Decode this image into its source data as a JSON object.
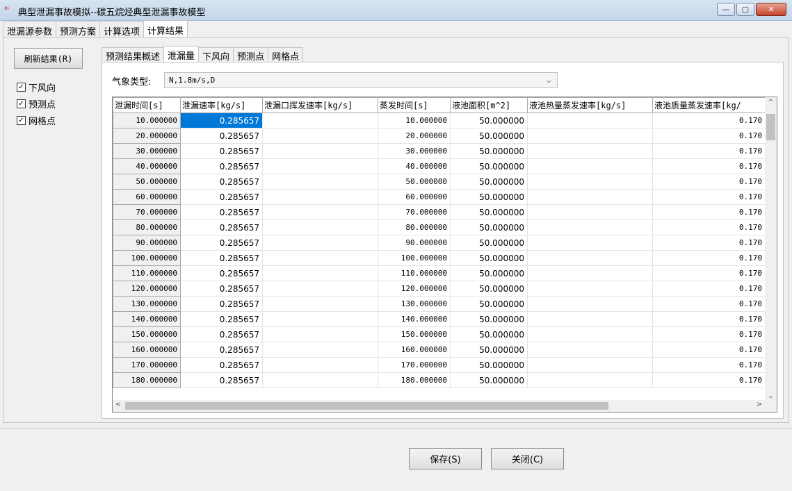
{
  "window": {
    "icon_text": "ᴿˢ",
    "title": "典型泄漏事故模拟--碳五烷烃典型泄漏事故模型",
    "buttons": {
      "minimize": "—",
      "maximize": "▢",
      "close": "✕"
    }
  },
  "outer_tabs": [
    {
      "label": "泄漏源参数",
      "active": false
    },
    {
      "label": "预测方案",
      "active": false
    },
    {
      "label": "计算选项",
      "active": false
    },
    {
      "label": "计算结果",
      "active": true
    }
  ],
  "left_panel": {
    "refresh_label": "刷新结果(R)",
    "checkboxes": [
      {
        "label": "下风向",
        "checked": true
      },
      {
        "label": "预测点",
        "checked": true
      },
      {
        "label": "网格点",
        "checked": true
      }
    ]
  },
  "inner_tabs": [
    {
      "label": "预测结果概述",
      "active": false
    },
    {
      "label": "泄漏量",
      "active": true
    },
    {
      "label": "下风向",
      "active": false
    },
    {
      "label": "预测点",
      "active": false
    },
    {
      "label": "网格点",
      "active": false
    }
  ],
  "weather": {
    "label": "气象类型:",
    "value": "N,1.8m/s,D",
    "chevron": "⌵"
  },
  "grid": {
    "headers": [
      "泄漏时间[s]",
      "泄漏速率[kg/s]",
      "泄漏口挥发速率[kg/s]",
      "蒸发时间[s]",
      "液池面积[m^2]",
      "液池热量蒸发速率[kg/s]",
      "液池质量蒸发速率[kg/"
    ],
    "rows": [
      [
        "10.000000",
        "0.285657",
        "",
        "10.000000",
        "50.000000",
        "",
        "0.170"
      ],
      [
        "20.000000",
        "0.285657",
        "",
        "20.000000",
        "50.000000",
        "",
        "0.170"
      ],
      [
        "30.000000",
        "0.285657",
        "",
        "30.000000",
        "50.000000",
        "",
        "0.170"
      ],
      [
        "40.000000",
        "0.285657",
        "",
        "40.000000",
        "50.000000",
        "",
        "0.170"
      ],
      [
        "50.000000",
        "0.285657",
        "",
        "50.000000",
        "50.000000",
        "",
        "0.170"
      ],
      [
        "60.000000",
        "0.285657",
        "",
        "60.000000",
        "50.000000",
        "",
        "0.170"
      ],
      [
        "70.000000",
        "0.285657",
        "",
        "70.000000",
        "50.000000",
        "",
        "0.170"
      ],
      [
        "80.000000",
        "0.285657",
        "",
        "80.000000",
        "50.000000",
        "",
        "0.170"
      ],
      [
        "90.000000",
        "0.285657",
        "",
        "90.000000",
        "50.000000",
        "",
        "0.170"
      ],
      [
        "100.000000",
        "0.285657",
        "",
        "100.000000",
        "50.000000",
        "",
        "0.170"
      ],
      [
        "110.000000",
        "0.285657",
        "",
        "110.000000",
        "50.000000",
        "",
        "0.170"
      ],
      [
        "120.000000",
        "0.285657",
        "",
        "120.000000",
        "50.000000",
        "",
        "0.170"
      ],
      [
        "130.000000",
        "0.285657",
        "",
        "130.000000",
        "50.000000",
        "",
        "0.170"
      ],
      [
        "140.000000",
        "0.285657",
        "",
        "140.000000",
        "50.000000",
        "",
        "0.170"
      ],
      [
        "150.000000",
        "0.285657",
        "",
        "150.000000",
        "50.000000",
        "",
        "0.170"
      ],
      [
        "160.000000",
        "0.285657",
        "",
        "160.000000",
        "50.000000",
        "",
        "0.170"
      ],
      [
        "170.000000",
        "0.285657",
        "",
        "170.000000",
        "50.000000",
        "",
        "0.170"
      ],
      [
        "180.000000",
        "0.285657",
        "",
        "180.000000",
        "50.000000",
        "",
        "0.170"
      ]
    ],
    "scroll_arrows": {
      "up": "^",
      "down": "⌄",
      "left": "<",
      "right": ">"
    }
  },
  "footer": {
    "save_label": "保存(S)",
    "close_label": "关闭(C)"
  }
}
